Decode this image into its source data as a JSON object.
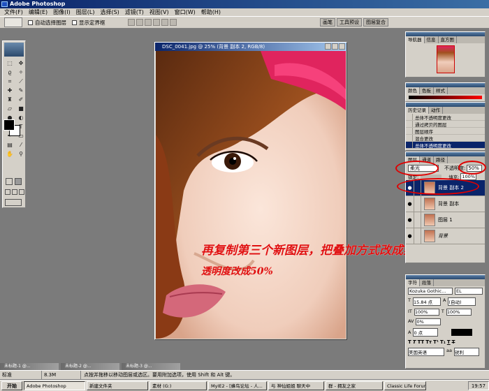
{
  "window": {
    "title": "Adobe Photoshop"
  },
  "menu": [
    "文件(F)",
    "编辑(E)",
    "图像(I)",
    "图层(L)",
    "选择(S)",
    "滤镜(T)",
    "视图(V)",
    "窗口(W)",
    "帮助(H)"
  ],
  "options": {
    "auto_select": "自动选择图层",
    "show_bounds": "显示定界框"
  },
  "palette_well": [
    "画笔",
    "工具预设",
    "图层复合"
  ],
  "document": {
    "title": "DSC_0041.jpg @ 25% (背景 副本 2, RGB/8)"
  },
  "annotation": {
    "line1": "再复制第三个新图层，把叠加方式改成柔光",
    "line2": "透明度改成50%"
  },
  "navigator": {
    "tabs": [
      "导航器",
      "信息",
      "直方图"
    ]
  },
  "color_panel": {
    "tabs": [
      "颜色",
      "色板",
      "样式"
    ]
  },
  "history": {
    "tabs": [
      "历史记录",
      "动作"
    ],
    "items": [
      "总体不透明度更改",
      "通过拷贝的图层",
      "图层顺序",
      "混合更改",
      "总体不透明度更改"
    ]
  },
  "layers": {
    "tabs": [
      "图层",
      "通道",
      "路径"
    ],
    "blend_mode": "柔光",
    "opacity_label": "不透明度:",
    "opacity": "50%",
    "lock_label": "锁定:",
    "fill_label": "填充:",
    "fill": "100%",
    "items": [
      {
        "name": "背景 副本 2",
        "selected": true
      },
      {
        "name": "背景 副本",
        "selected": false
      },
      {
        "name": "图层 1",
        "selected": false
      },
      {
        "name": "背景",
        "selected": false
      }
    ]
  },
  "character": {
    "tabs": [
      "字符",
      "段落"
    ],
    "font": "Kozuka Gothic...",
    "style": "EL",
    "size": "15.84 点",
    "leading": "(自动)",
    "scale_v": "100%",
    "scale_h": "100%",
    "tracking": "0%",
    "baseline": "0 点",
    "language": "美国英语",
    "aa": "锐利"
  },
  "minidocs": [
    "未标题-1 @...",
    "未标题-2 @...",
    "未标题-3 @..."
  ],
  "status": {
    "zoom": "标准",
    "size": "8.3M",
    "hint": "点按并拖移以移动图层或选区。要用附加选项，使用 Shift 和 Alt 键。"
  },
  "taskbar": {
    "start": "开始",
    "tasks": [
      "Adobe Photoshop",
      "新建文件夹",
      "素材 (G:)",
      "MyIE2 - [蜂鸟论坛 - 人...",
      "与 神仙姐姐 聊天中",
      "群 - 拥友之家",
      "Classic Life Forum - [人..."
    ],
    "clock": "19:57"
  }
}
